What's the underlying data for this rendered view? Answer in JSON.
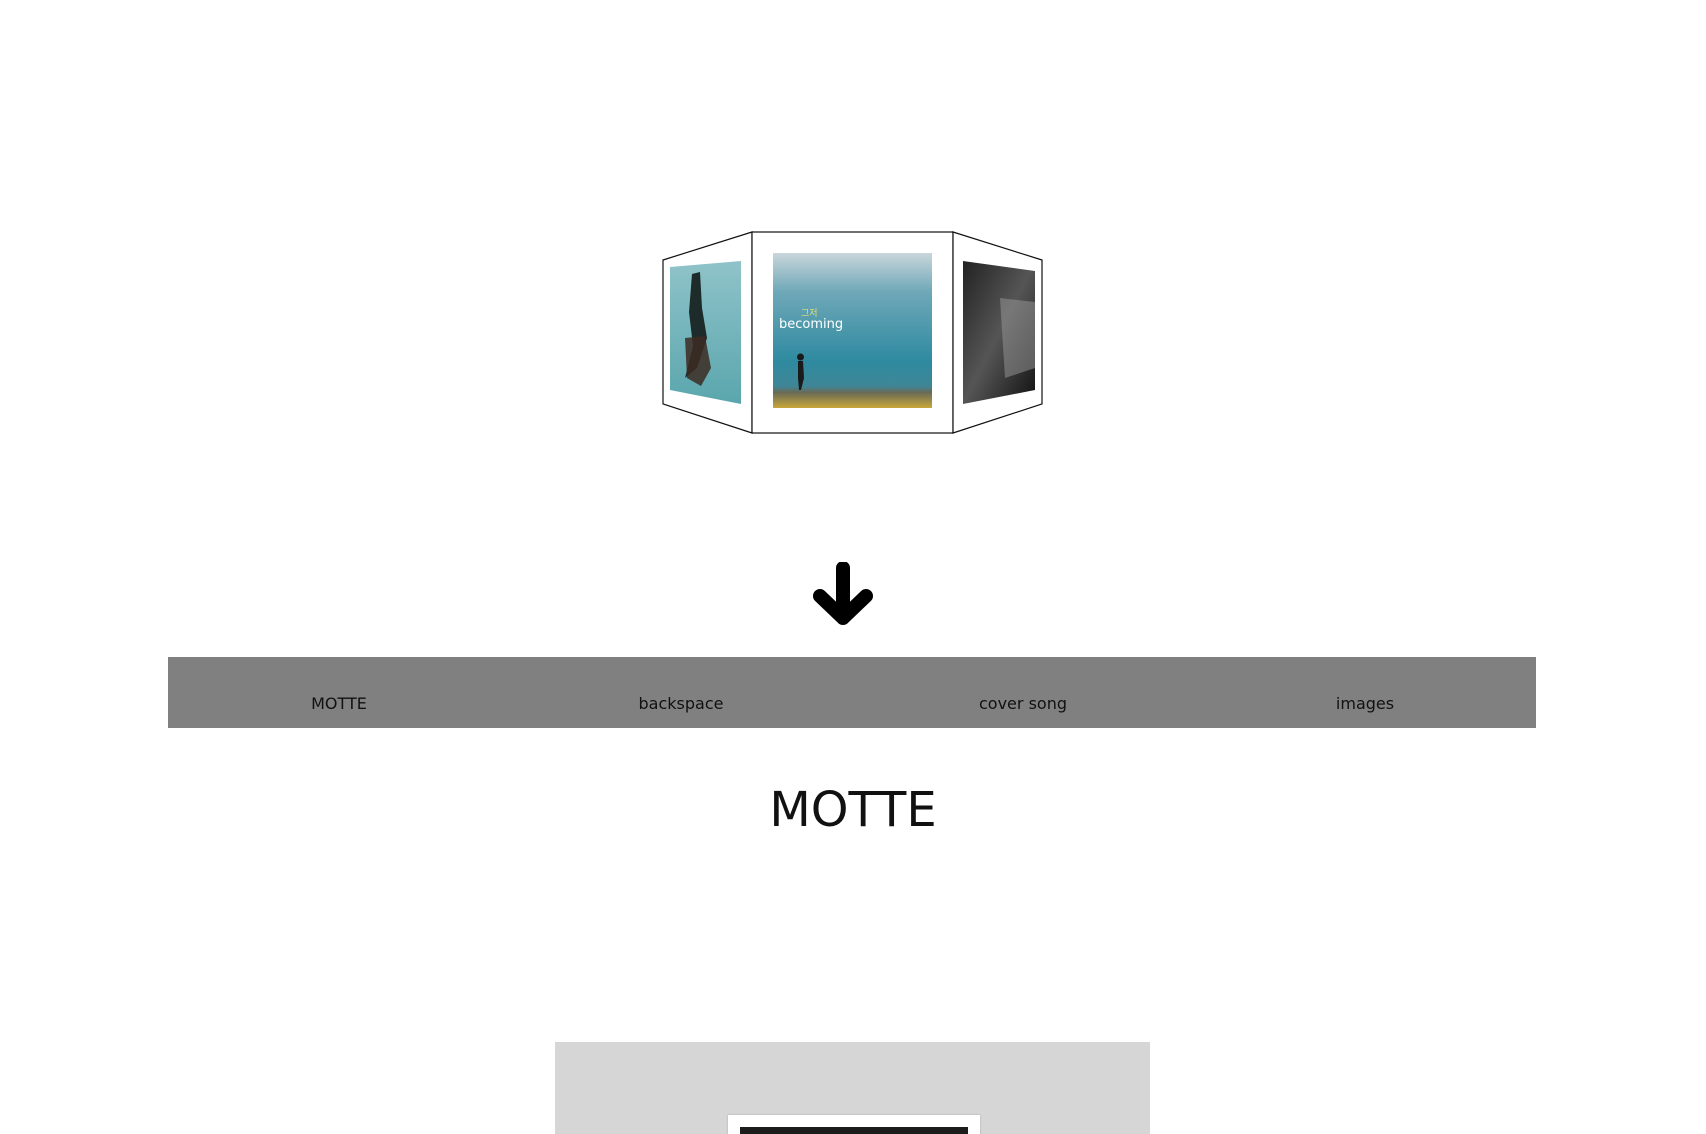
{
  "carousel": {
    "center_caption_small": "그저",
    "center_caption": "becoming"
  },
  "nav": {
    "items": [
      {
        "label": "MOTTE"
      },
      {
        "label": "backspace"
      },
      {
        "label": "cover song"
      },
      {
        "label": "images"
      }
    ]
  },
  "section": {
    "title": "MOTTE"
  },
  "colors": {
    "navbar_bg": "#808080",
    "card_bg": "#d6d6d6",
    "text": "#111111"
  },
  "icons": {
    "scroll": "arrow-down-icon"
  }
}
